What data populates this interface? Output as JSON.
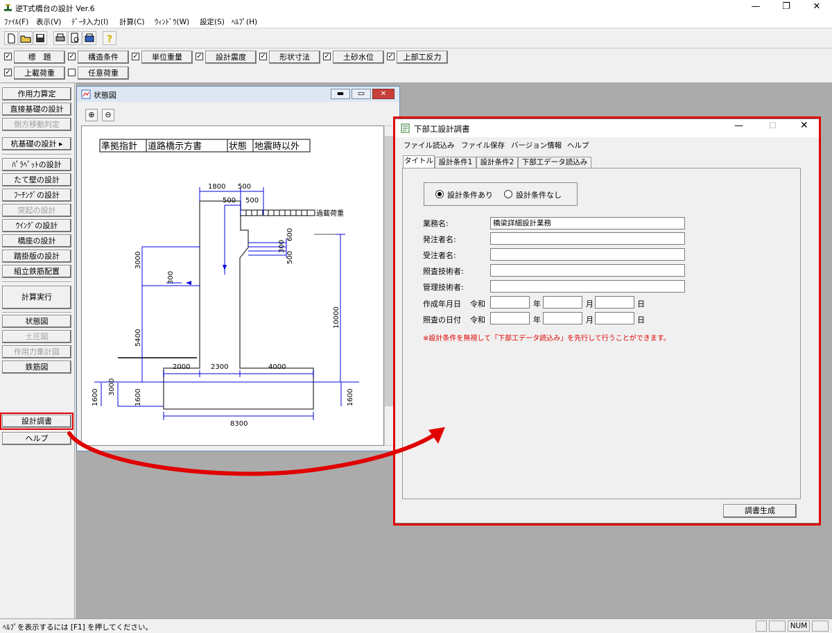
{
  "app": {
    "title": "逆T式橋台の設計 Ver.6"
  },
  "menu": [
    "ﾌｧｲﾙ(F)",
    "表示(V)",
    "ﾃﾞｰﾀ入力(I)",
    "計算(C)",
    "ｳｨﾝﾄﾞｳ(W)",
    "設定(S)",
    "ﾍﾙﾌﾟ(H)"
  ],
  "toolbar_icons": [
    "new-file-icon",
    "open-folder-icon",
    "save-disk-icon",
    "print-icon",
    "print-preview-icon",
    "printer-setup-icon",
    "help-question-icon"
  ],
  "input_buttons": [
    {
      "label": "標　題",
      "checked": true
    },
    {
      "label": "構造条件",
      "checked": true
    },
    {
      "label": "単位重量",
      "checked": true
    },
    {
      "label": "設計震度",
      "checked": true
    },
    {
      "label": "形状寸法",
      "checked": true
    },
    {
      "label": "土砂水位",
      "checked": true
    },
    {
      "label": "上部工反力",
      "checked": true
    },
    {
      "label": "上載荷重",
      "checked": true
    },
    {
      "label": "任意荷重",
      "checked": false
    }
  ],
  "sidebar": [
    {
      "label": "作用力算定",
      "enabled": true
    },
    {
      "label": "直接基礎の設計",
      "enabled": true
    },
    {
      "label": "側方移動判定",
      "enabled": false
    },
    {
      "label": "杭基礎の設計",
      "enabled": true,
      "arrow": "▸"
    },
    {
      "label": "ﾊﾟﾗﾍﾟｯﾄの設計",
      "enabled": true
    },
    {
      "label": "たて壁の設計",
      "enabled": true
    },
    {
      "label": "ﾌｰﾁﾝｸﾞの設計",
      "enabled": true
    },
    {
      "label": "突起の設計",
      "enabled": false
    },
    {
      "label": "ｳｲﾝｸﾞの設計",
      "enabled": true
    },
    {
      "label": "橋座の設計",
      "enabled": true
    },
    {
      "label": "踏掛版の設計",
      "enabled": true
    },
    {
      "label": "組立鉄筋配置",
      "enabled": true
    },
    {
      "label": "計算実行",
      "enabled": true
    },
    {
      "label": "状態図",
      "enabled": true
    },
    {
      "label": "土圧図",
      "enabled": false
    },
    {
      "label": "作用力集計図",
      "enabled": false
    },
    {
      "label": "鉄筋図",
      "enabled": true
    },
    {
      "label": "設計調書",
      "enabled": true
    },
    {
      "label": "ヘルプ",
      "enabled": true
    }
  ],
  "state_window": {
    "title": "状態図",
    "header": [
      "準拠指針",
      "道路橋示方書",
      "状態",
      "地震時以外"
    ],
    "dims": {
      "d1800": "1800",
      "d500a": "500",
      "d500b": "500",
      "d500c": "500",
      "d600": "600",
      "d300a": "300",
      "d500d": "500",
      "d3000a": "3000",
      "d300b": "300",
      "d5400": "5400",
      "d10000": "10000",
      "d2000": "2000",
      "d2300": "2300",
      "d4000": "4000",
      "d3000b": "3000",
      "d1600a": "1600",
      "d1600b": "1600",
      "d1600c": "1600",
      "d8300": "8300"
    },
    "overload_label": "過載荷重"
  },
  "design_window": {
    "title": "下部工設計調書",
    "menu": [
      "ファイル読込み",
      "ファイル保存",
      "バージョン情報",
      "ヘルプ"
    ],
    "tabs": [
      "タイトル",
      "設計条件1",
      "設計条件2",
      "下部工データ読込み"
    ],
    "radio": {
      "option1": "設計条件あり",
      "option2": "設計条件なし",
      "selected": "option1"
    },
    "fields": {
      "business_label": "業務名:",
      "business_value": "橋梁詳細設計業務",
      "orderer_label": "発注者名:",
      "contractor_label": "受注者名:",
      "checker_label": "照査技術者:",
      "manager_label": "管理技術者:"
    },
    "date_created": {
      "label": "作成年月日",
      "era": "令和",
      "year": "年",
      "month": "月",
      "day": "日"
    },
    "date_checked": {
      "label": "照査の日付",
      "era": "令和",
      "year": "年",
      "month": "月",
      "day": "日"
    },
    "note": "※設計条件を無視して「下部工データ読込み」を先行して行うことができます。",
    "generate_button": "調書生成"
  },
  "status": {
    "help_text": "ﾍﾙﾌﾟを表示するには [F1] を押してください。",
    "num": "NUM"
  },
  "colors": {
    "highlight": "#e00000",
    "dimension": "#0000dd",
    "structure": "#555555"
  }
}
